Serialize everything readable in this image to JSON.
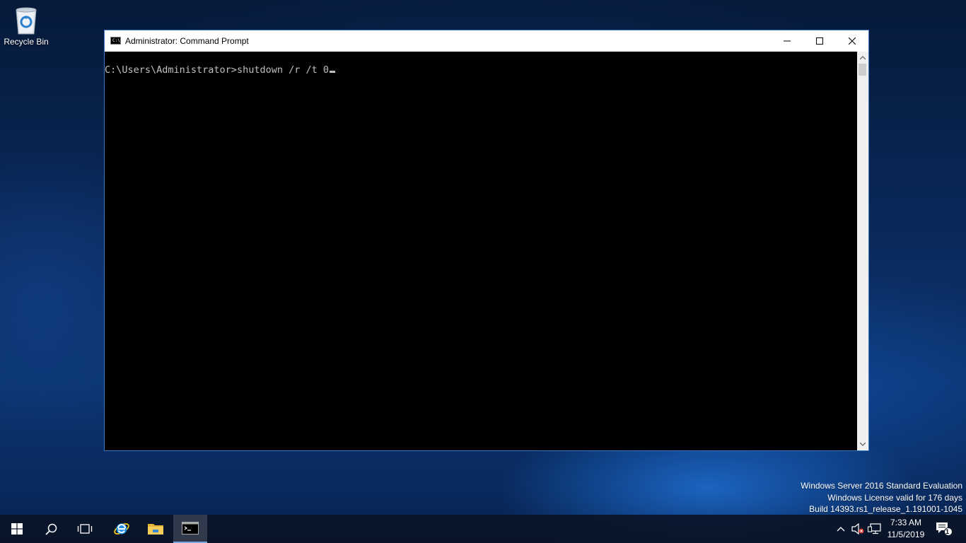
{
  "desktop": {
    "recycle_bin_label": "Recycle Bin",
    "recycle_bin_icon": "recycle-bin-icon"
  },
  "window": {
    "title": "Administrator: Command Prompt",
    "icon": "cmd-icon",
    "icon_text": "C:\\",
    "controls": [
      "minimize-icon",
      "maximize-icon",
      "close-icon"
    ],
    "border_color": "#3a78c6"
  },
  "console": {
    "prompt": "C:\\Users\\Administrator>",
    "command": "shutdown /r /t 0",
    "text_color": "#c0c0c0",
    "background": "#000000"
  },
  "watermark": {
    "line1": "Windows Server 2016 Standard Evaluation",
    "line2": "Windows License valid for 176 days",
    "line3": "Build 14393.rs1_release_1.191001-1045"
  },
  "taskbar": {
    "buttons": [
      "start-icon",
      "search-icon",
      "task-view-icon",
      "internet-explorer-icon",
      "file-explorer-icon",
      "command-prompt-icon"
    ],
    "active": "command-prompt-icon",
    "tray": [
      "show-hidden-icons-icon",
      "volume-muted-icon",
      "network-icon"
    ],
    "time": "7:33 AM",
    "date": "11/5/2019",
    "notifications_count": "1"
  }
}
